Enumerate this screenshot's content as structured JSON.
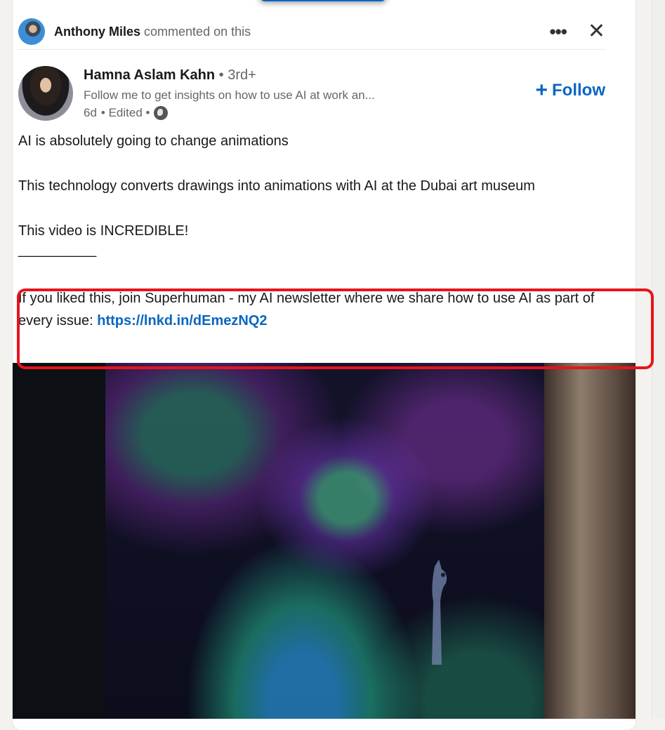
{
  "context": {
    "actor_name": "Anthony Miles",
    "action_text": "commented on this",
    "more_icon": "more-horizontal-icon",
    "close_icon": "close-icon"
  },
  "author": {
    "name": "Hamna Aslam Kahn",
    "degree": "• 3rd+",
    "headline": "Follow me to get insights on how to use AI at work an...",
    "time": "6d",
    "edited": "• Edited •",
    "visibility_icon": "globe-icon",
    "follow_plus": "+",
    "follow_label": "Follow"
  },
  "post": {
    "line1": "AI is absolutely going to change animations",
    "line2": "This technology converts drawings into animations with AI at the Dubai art museum",
    "line3": "This video is INCREDIBLE!",
    "separator": "__________",
    "cta_text": "If you liked this, join Superhuman - my AI newsletter where we share how to use AI as part of every issue: ",
    "cta_link": "https://lnkd.in/dEmezNQ2"
  },
  "media": {
    "type": "video",
    "description": "Animated glowing creature among neon plants"
  },
  "colors": {
    "accent": "#0a66c2",
    "highlight": "#e8141b"
  }
}
